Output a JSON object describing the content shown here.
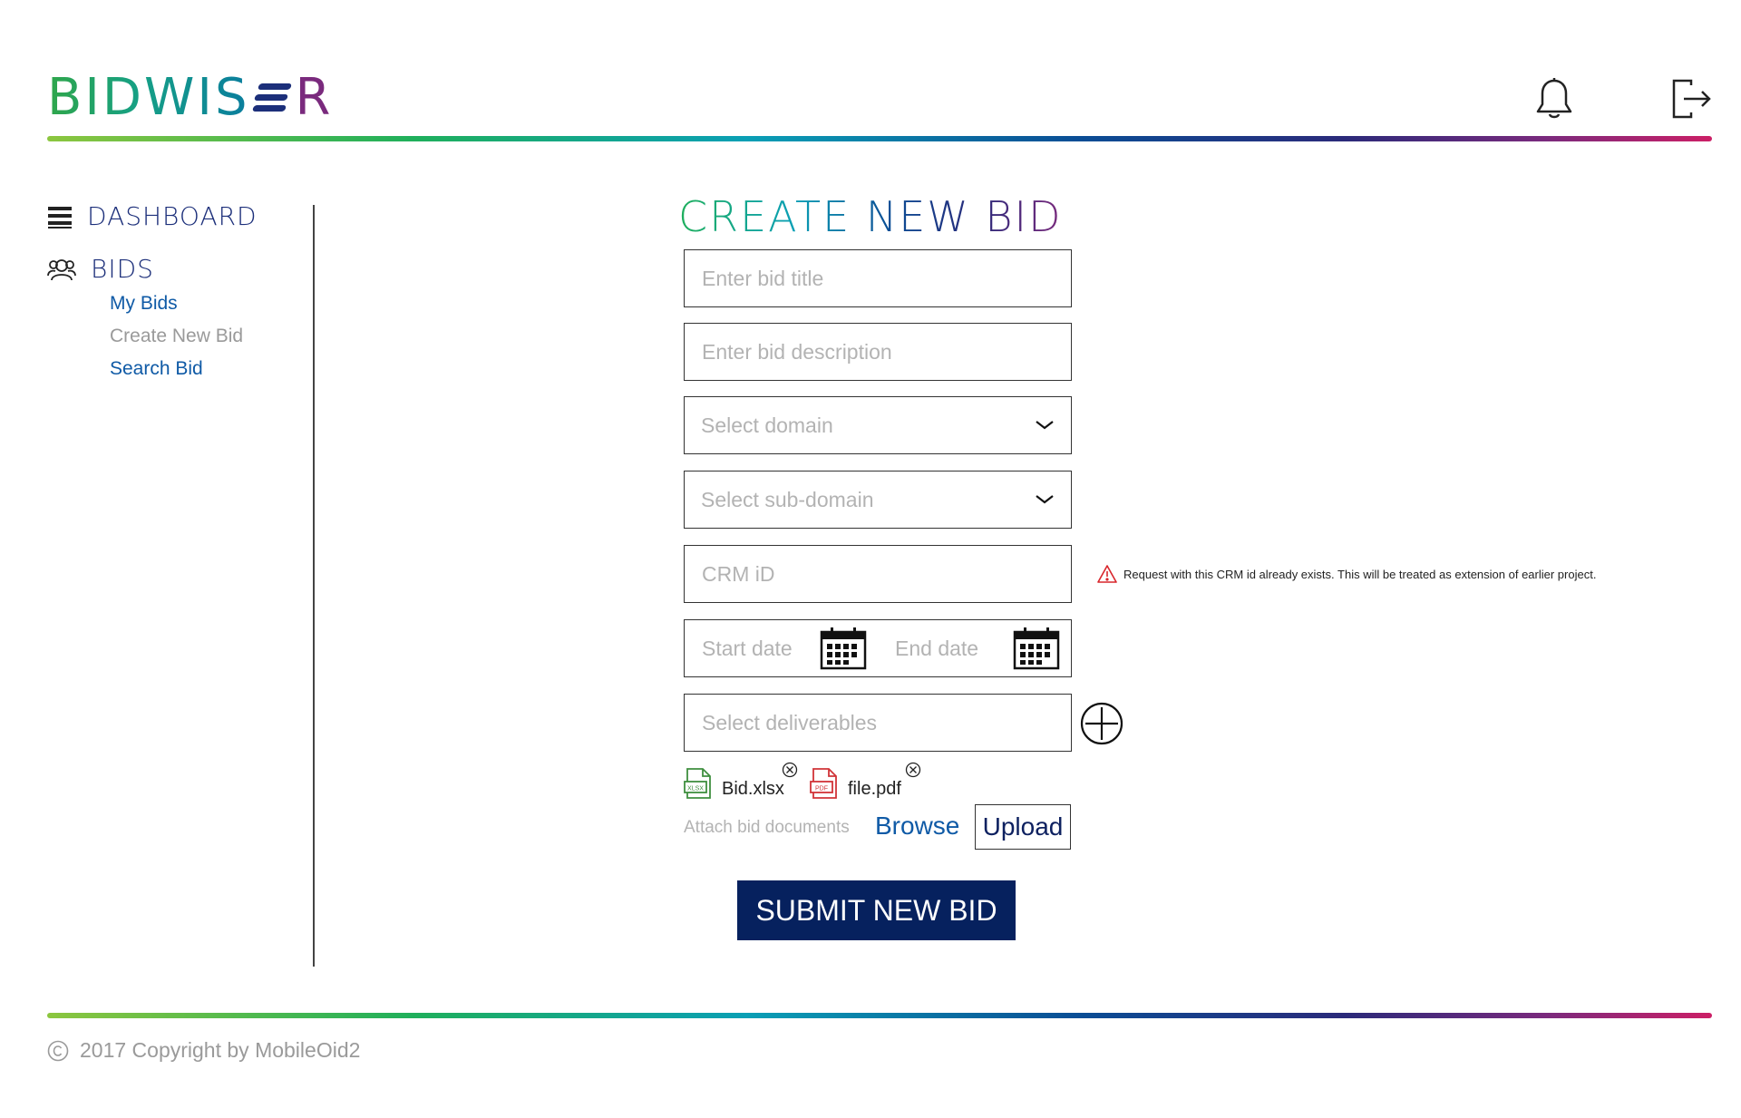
{
  "header": {
    "logo_part1": "BIDWIS",
    "logo_part2": "R",
    "notifications_icon": "bell-icon",
    "logout_icon": "logout-icon"
  },
  "sidebar": {
    "dashboard_label": "DASHBOARD",
    "bids_label": "BIDS",
    "bids_items": [
      {
        "label": "My Bids"
      },
      {
        "label": "Create New Bid"
      },
      {
        "label": "Search Bid"
      }
    ]
  },
  "form": {
    "title": "CREATE NEW BID",
    "bid_title_placeholder": "Enter bid title",
    "bid_description_placeholder": "Enter bid description",
    "domain_placeholder": "Select domain",
    "subdomain_placeholder": "Select sub-domain",
    "crm_id_placeholder": "CRM iD",
    "crm_warning": "Request with this CRM id already exists. This will be treated as extension of earlier project.",
    "start_date_placeholder": "Start date",
    "end_date_placeholder": "End date",
    "deliverables_placeholder": "Select deliverables",
    "attachments": [
      {
        "name": "Bid.xlsx",
        "type_tag": "XLSX",
        "color": "#3f8f3f"
      },
      {
        "name": "file.pdf",
        "type_tag": "PDF",
        "color": "#d13438"
      }
    ],
    "attach_label": "Attach bid documents",
    "browse_label": "Browse",
    "upload_label": "Upload",
    "submit_label": "SUBMIT NEW BID"
  },
  "footer": {
    "copyright": "2017 Copyright by MobileOid2"
  },
  "colors": {
    "brand_navy": "#06215e",
    "link_blue": "#0f5aa6",
    "warning_red": "#d9262c"
  }
}
